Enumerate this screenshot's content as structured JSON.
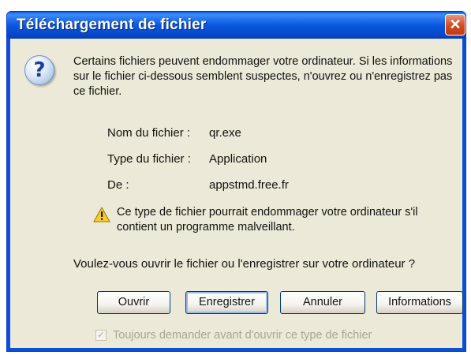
{
  "window": {
    "title": "Téléchargement de fichier",
    "close_symbol": "✕"
  },
  "dialog": {
    "icon": "question-icon",
    "intro": "Certains fichiers peuvent endommager votre ordinateur. Si les informations sur le fichier ci-dessous semblent suspectes, n'ouvrez ou n'enregistrez pas ce fichier.",
    "file_info": {
      "name_label": "Nom du fichier :",
      "name_value": "qr.exe",
      "type_label": "Type du fichier :",
      "type_value": "Application",
      "from_label": "De :",
      "from_value": "appstmd.free.fr"
    },
    "warning_icon": "warning-icon",
    "warning": "Ce type de fichier pourrait endommager votre ordinateur s'il contient un programme malveillant.",
    "question": "Voulez-vous ouvrir le fichier ou l'enregistrer sur votre ordinateur ?",
    "buttons": {
      "open": "Ouvrir",
      "save": "Enregistrer",
      "cancel": "Annuler",
      "info": "Informations"
    },
    "checkbox": {
      "label": "Toujours demander avant d'ouvrir ce type de fichier",
      "checked": true,
      "check_glyph": "✓"
    }
  }
}
